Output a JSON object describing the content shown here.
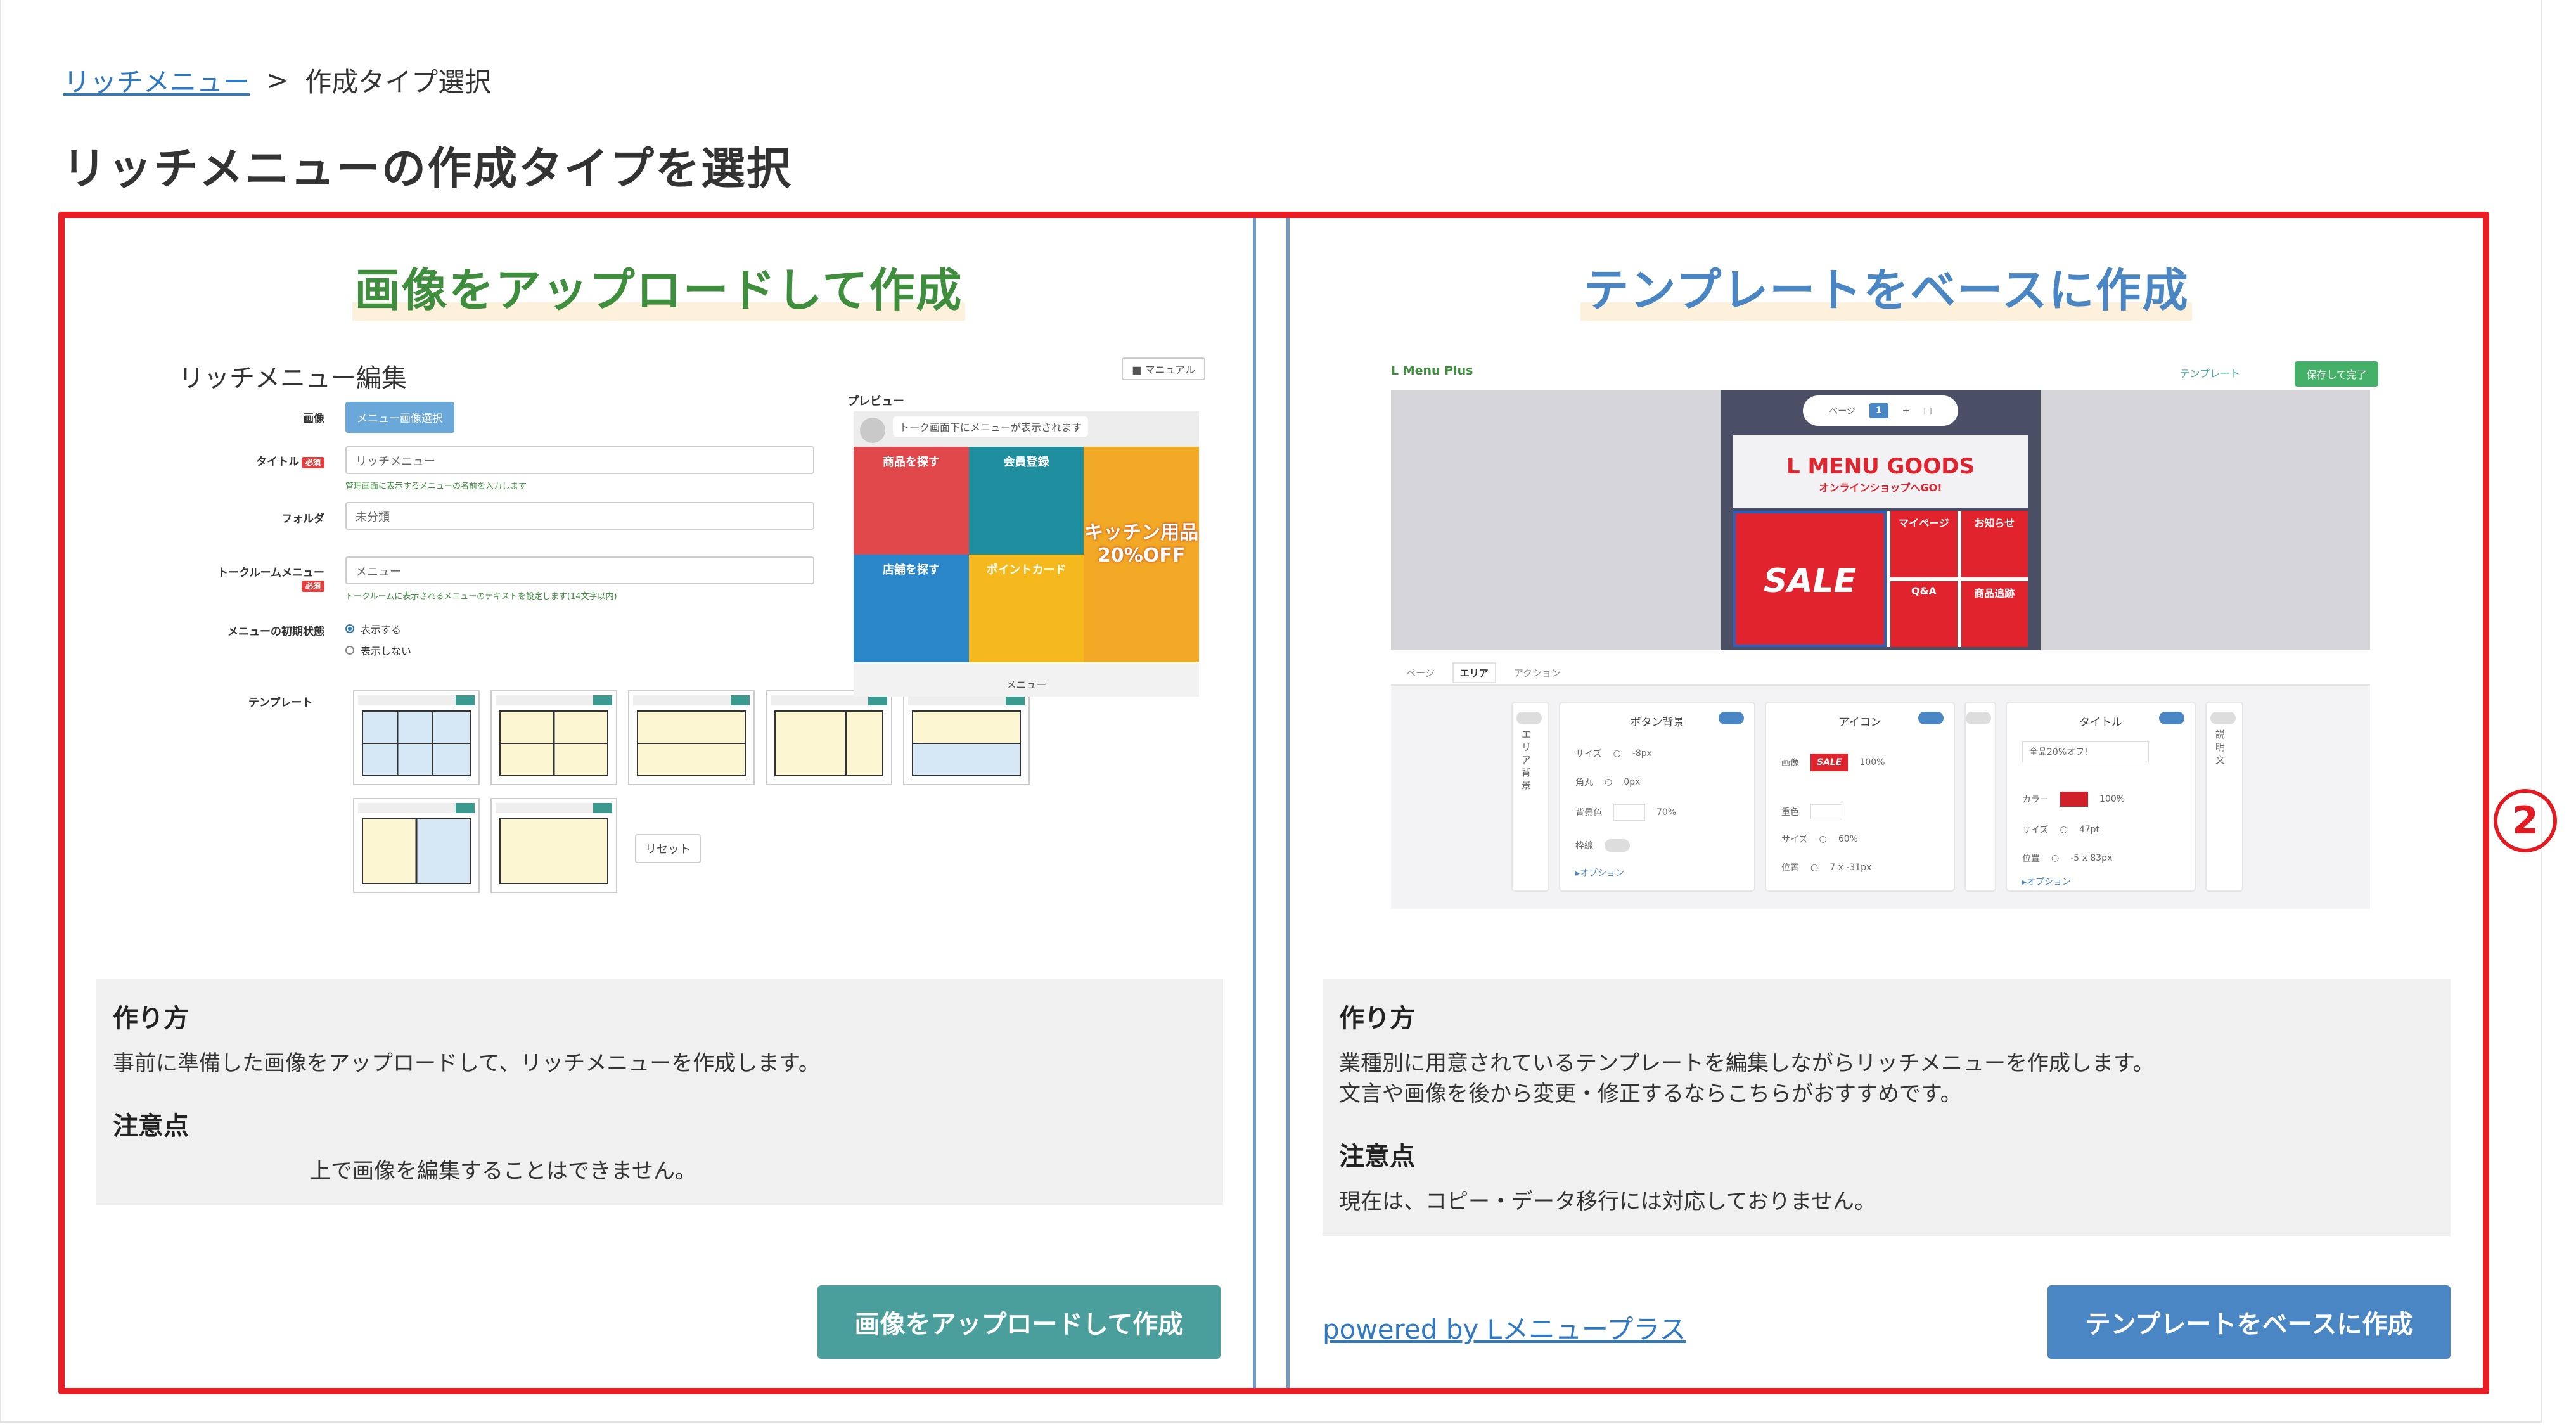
{
  "breadcrumb": {
    "link": "リッチメニュー",
    "separator": ">",
    "current": "作成タイプ選択"
  },
  "page_title": "リッチメニューの作成タイプを選択",
  "marker": "2",
  "left_card": {
    "title": "画像をアップロードして作成",
    "howto_heading": "作り方",
    "howto_text": "事前に準備した画像をアップロードして、リッチメニューを作成します。",
    "notes_heading": "注意点",
    "notes_text": "上で画像を編集することはできません。",
    "button": "画像をアップロードして作成",
    "mock": {
      "title": "リッチメニュー編集",
      "manual": "■ マニュアル",
      "label_image": "画像",
      "select_image_btn": "メニュー画像選択",
      "label_title": "タイトル",
      "required": "必須",
      "title_value": "リッチメニュー",
      "title_hint": "管理画面に表示するメニューの名前を入力します",
      "label_folder": "フォルダ",
      "folder_value": "未分類",
      "label_talkroom": "トークルームメニュー",
      "talkroom_value": "メニュー",
      "talkroom_hint": "トークルームに表示されるメニューのテキストを設定します(14文字以内)",
      "label_initial": "メニューの初期状態",
      "radio_show": "表示する",
      "radio_hide": "表示しない",
      "label_template": "テンプレート",
      "reset": "リセット",
      "preview_label": "プレビュー",
      "preview_msg": "トーク画面下にメニューが表示されます",
      "tiles": [
        "商品を探す",
        "会員登録",
        "キッチン用品 20%OFF",
        "店舗を探す",
        "ポイントカード"
      ],
      "menu_footer": "メニュー"
    }
  },
  "right_card": {
    "title": "テンプレートをベースに作成",
    "howto_heading": "作り方",
    "howto_text_1": "業種別に用意されているテンプレートを編集しながらリッチメニューを作成します。",
    "howto_text_2": "文言や画像を後から変更・修正するならこちらがおすすめです。",
    "notes_heading": "注意点",
    "notes_text": "現在は、コピー・データ移行には対応しておりません。",
    "powered": "powered by Lメニュープラス",
    "button": "テンプレートをベースに作成",
    "mock": {
      "brand": "L Menu Plus",
      "template_link": "テンプレート",
      "save_btn": "保存して完了",
      "pager_label": "ページ",
      "pager_page": "1",
      "goods": "L MENU GOODS",
      "goods_sub": "オンラインショップへGO!",
      "sale": "SALE",
      "sale_sub": "全品20%オフ!",
      "cells": [
        "マイページ",
        "お知らせ",
        "Q&A",
        "商品追跡"
      ],
      "tabs": [
        "ページ",
        "エリア",
        "アクション"
      ],
      "panel_area": "エリア背景",
      "panel_button": "ボタン背景",
      "panel_icon": "アイコン",
      "panel_title": "タイトル",
      "panel_desc": "説明文",
      "size": "サイズ",
      "corner": "角丸",
      "bgcolor": "背景色",
      "border": "枠線",
      "image": "画像",
      "layer": "重色",
      "position": "位置",
      "color": "カラー",
      "option": "▸オプション",
      "v_size": "-8px",
      "v_corner": "0px",
      "v_opacity": "70%",
      "v_icon_opacity": "100%",
      "v_icon_size": "60%",
      "v_icon_pos": "7 x -31px",
      "v_title_text": "全品20%オフ!",
      "v_title_color": "100%",
      "v_title_size": "47pt",
      "v_title_pos": "-5 x 83px"
    }
  },
  "colors": {
    "accent_red": "#ea1d25",
    "green": "#3e8e3e",
    "blue": "#4a86c4",
    "teal": "#4a9e9b"
  }
}
